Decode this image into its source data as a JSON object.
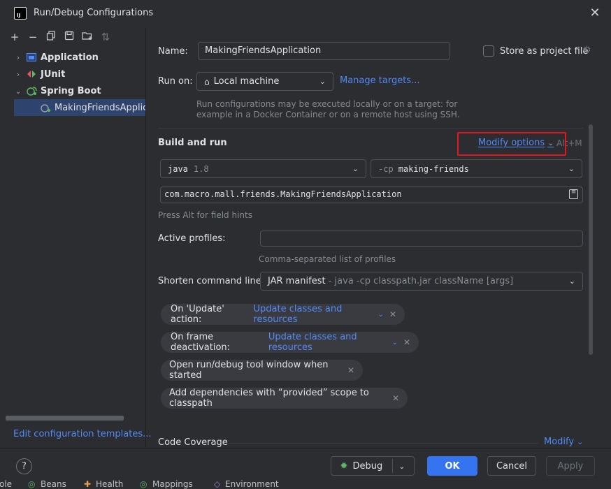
{
  "window": {
    "title": "Run/Debug Configurations",
    "app_icon_letter": "IJ"
  },
  "left_toolbar": {
    "icons": [
      "add-icon",
      "remove-icon",
      "copy-icon",
      "save-icon",
      "new-folder-icon",
      "sort-icon"
    ]
  },
  "tree": {
    "items": [
      {
        "label": "Application",
        "icon": "application-icon"
      },
      {
        "label": "JUnit",
        "icon": "junit-icon"
      },
      {
        "label": "Spring Boot",
        "icon": "spring-boot-icon"
      },
      {
        "label": "MakingFriendsApplicat",
        "icon": "spring-boot-run-icon"
      }
    ]
  },
  "edit_templates_link": "Edit configuration templates...",
  "form": {
    "name_label": "Name:",
    "name_value": "MakingFriendsApplication",
    "store_label": "Store as project file",
    "run_on_label": "Run on:",
    "run_on_value": "Local machine",
    "manage_targets": "Manage targets...",
    "run_on_hint_1": "Run configurations may be executed locally or on a target: for",
    "run_on_hint_2": "example in a Docker Container or on a remote host using SSH.",
    "build_run_title": "Build and run",
    "modify_options": "Modify options",
    "modify_shortcut": "Alt+M",
    "jdk_name": "java",
    "jdk_version": "1.8",
    "cp_flag": "-cp",
    "cp_value": "making-friends",
    "main_class": "com.macro.mall.friends.MakingFriendsApplication",
    "field_hint": "Press Alt for field hints",
    "active_profiles_label": "Active profiles:",
    "active_profiles_value": "",
    "profiles_hint": "Comma-separated list of profiles",
    "shorten_label": "Shorten command line:",
    "shorten_value": "JAR manifest",
    "shorten_detail": " - java -cp classpath.jar className [args]",
    "chips": {
      "update_action_label": "On 'Update' action:",
      "update_action_value": "Update classes and resources",
      "frame_deactivation_label": "On frame deactivation:",
      "frame_deactivation_value": "Update classes and resources",
      "open_tool_window": "Open run/debug tool window when started",
      "add_dependencies": "Add dependencies with “provided” scope to classpath"
    },
    "code_coverage_title": "Code Coverage",
    "code_coverage_modify": "Modify"
  },
  "footer": {
    "help": "?",
    "debug": "Debug",
    "ok": "OK",
    "cancel": "Cancel",
    "apply": "Apply"
  },
  "statusbar": {
    "items": [
      "ole",
      "Beans",
      "Health",
      "Mappings",
      "Environment"
    ]
  },
  "colors": {
    "accent": "#3574f0",
    "link": "#548af7",
    "highlight_box": "#e5161d",
    "selection": "#2e436e"
  }
}
